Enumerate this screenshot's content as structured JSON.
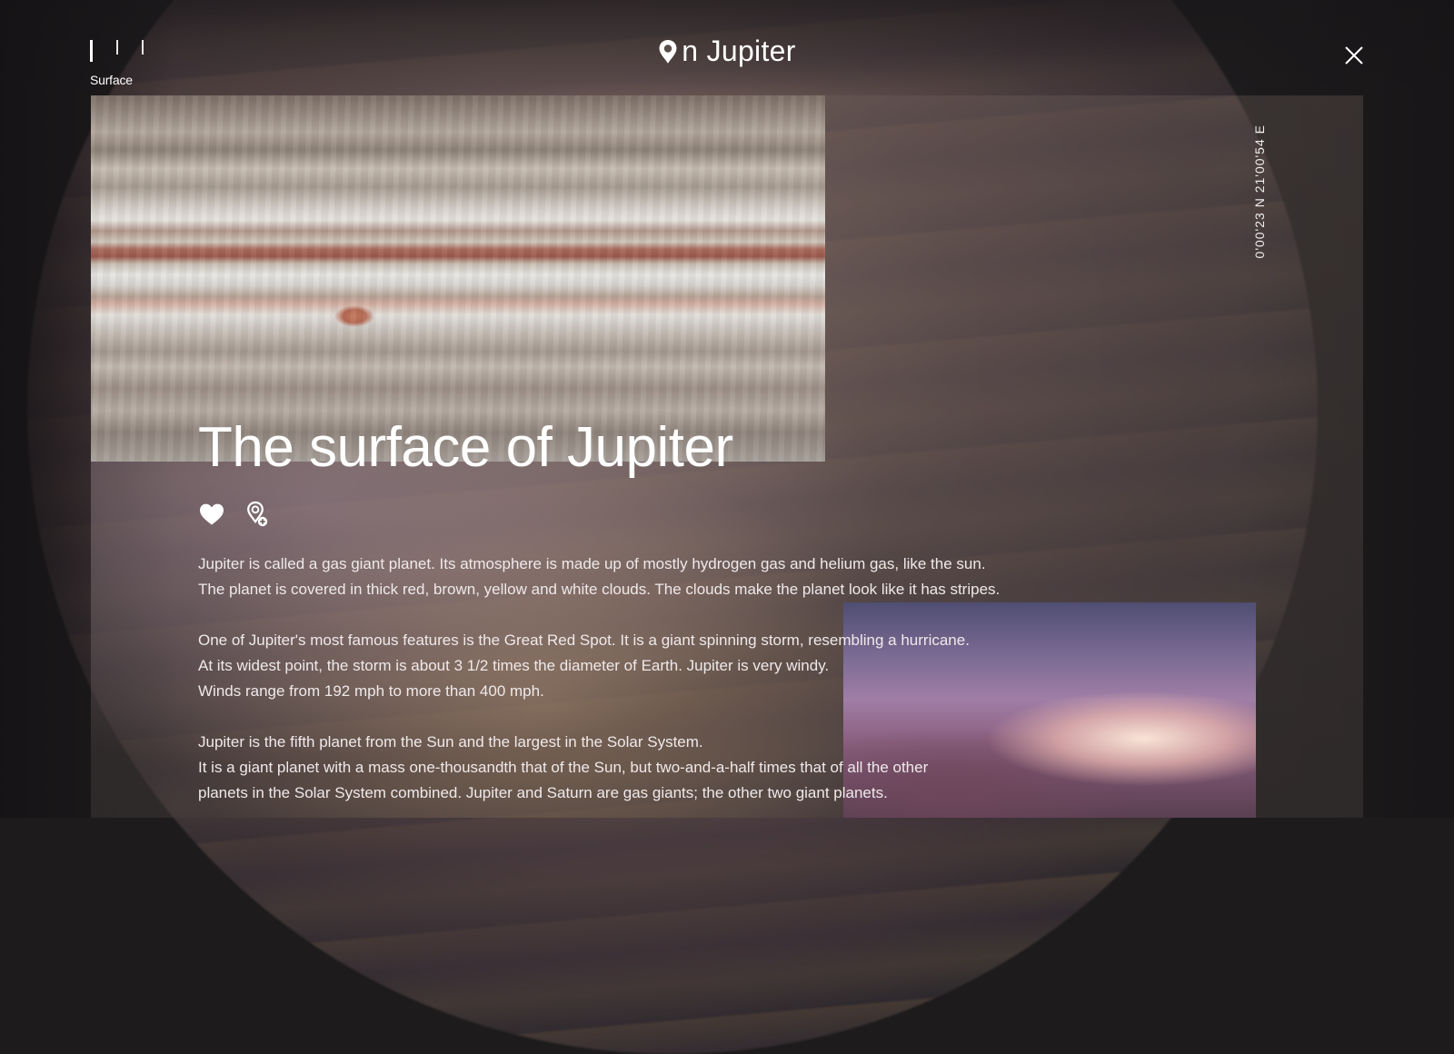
{
  "header": {
    "brand_text": "n Jupiter",
    "brand_icon": "location-pin-icon",
    "close_icon": "close-icon",
    "pager": {
      "label": "Surface",
      "pages": 3,
      "active_index": 0
    }
  },
  "article": {
    "title": "The surface of Jupiter",
    "coordinates": "0'00'23 N 21'00'54 E",
    "actions": {
      "favorite_icon": "heart-icon",
      "add_location_icon": "add-location-pin-icon"
    },
    "paragraphs": [
      "Jupiter is called a gas giant planet. Its atmosphere is made up of mostly hydrogen gas and helium gas, like the sun.\nThe planet is covered in thick red, brown, yellow and white clouds. The clouds make the planet look like it has stripes.",
      "One of Jupiter's most famous features is the Great Red Spot. It is a giant spinning storm, resembling a hurricane.\nAt its widest point, the storm is about 3 1/2 times the diameter of Earth. Jupiter is very windy.\nWinds range from 192 mph to more than 400 mph.",
      "Jupiter is the fifth planet from the Sun and the largest in the Solar System.\nIt is a giant planet with a mass one-thousandth that of the Sun, but two-and-a-half times that of all the other\nplanets in the Solar System combined. Jupiter and Saturn are gas giants; the other two giant planets."
    ]
  },
  "colors": {
    "text": "#ffffff",
    "body_text": "#efe9ea",
    "background": "#1d1b1c"
  }
}
